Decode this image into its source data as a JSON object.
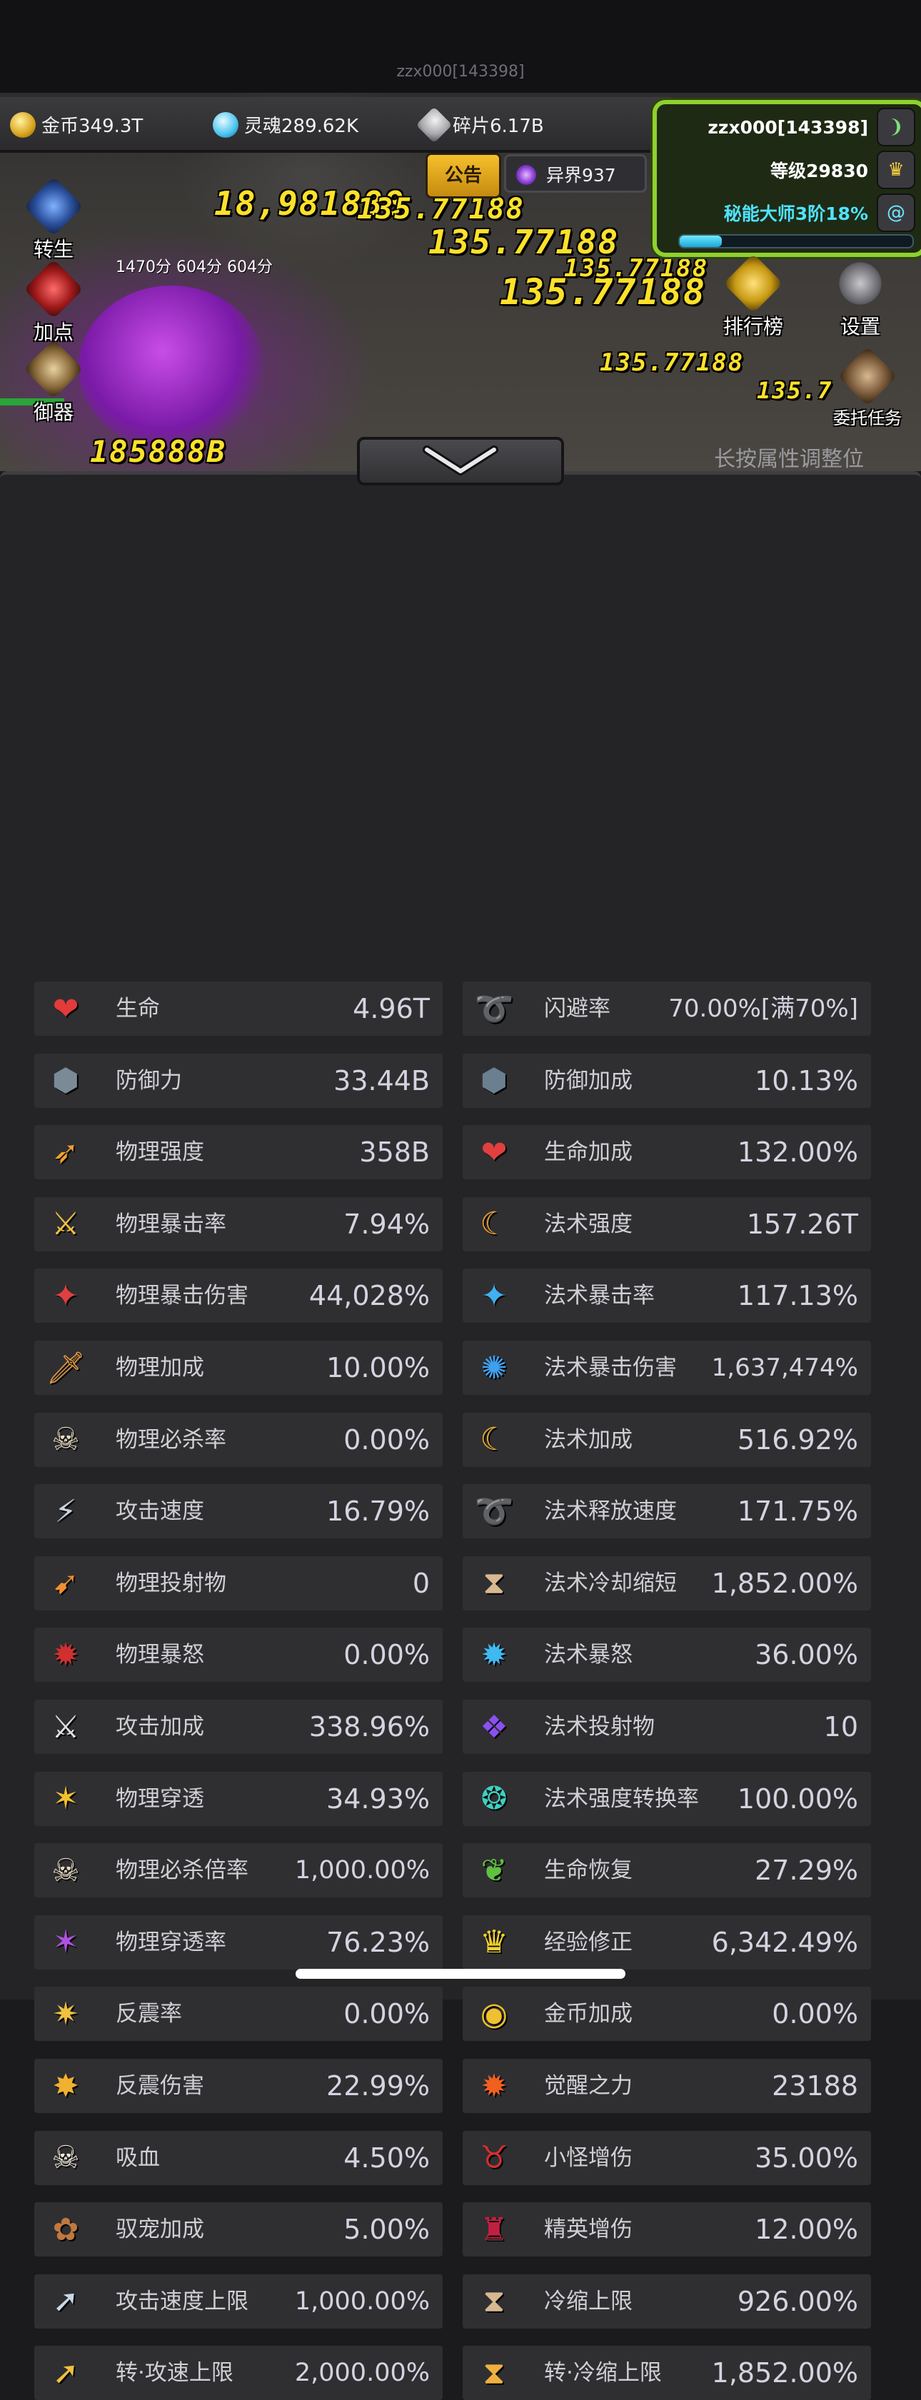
{
  "header": {
    "server_label": "zzx000[143398]",
    "resources": [
      {
        "icon": "gold-coin-icon",
        "label": "金币349.3T"
      },
      {
        "icon": "soul-icon",
        "label": "灵魂289.62K"
      },
      {
        "icon": "shard-icon",
        "label": "碎片6.17B"
      }
    ]
  },
  "player": {
    "name": "zzx000[143398]",
    "level": "等级29830",
    "title": "秘能大师3阶18%",
    "progress": 0.18
  },
  "buttons": {
    "notice": "公告",
    "realm": "异界937",
    "rebirth": "转生",
    "add_points": "加点",
    "gear": "御器",
    "leaderboard": "排行榜",
    "settings": "设置",
    "commission": "委托任务"
  },
  "scene": {
    "hint": "长按属性调整位",
    "small_label": "1470分 604分  604分",
    "damage_numbers": [
      "18,981888",
      "135.77188",
      "135.77188",
      "135.77188",
      "135.77188",
      "135.77188",
      "185888B",
      "135.7"
    ]
  },
  "stats_left": [
    {
      "icon": "heart-icon",
      "name": "生命",
      "value": "4.96T"
    },
    {
      "icon": "shield-icon",
      "name": "防御力",
      "value": "33.44B"
    },
    {
      "icon": "arrow-burst-icon",
      "name": "物理强度",
      "value": "358B"
    },
    {
      "icon": "crit-swords-icon",
      "name": "物理暴击率",
      "value": "7.94%"
    },
    {
      "icon": "crit-damage-icon",
      "name": "物理暴击伤害",
      "value": "44,028%"
    },
    {
      "icon": "sword-plus-icon",
      "name": "物理加成",
      "value": "10.00%"
    },
    {
      "icon": "skull-dagger-icon",
      "name": "物理必杀率",
      "value": "0.00%"
    },
    {
      "icon": "attack-speed-icon",
      "name": "攻击速度",
      "value": "16.79%"
    },
    {
      "icon": "projectile-icon",
      "name": "物理投射物",
      "value": "0"
    },
    {
      "icon": "rage-icon",
      "name": "物理暴怒",
      "value": "0.00%"
    },
    {
      "icon": "crossed-swords-icon",
      "name": "攻击加成",
      "value": "338.96%"
    },
    {
      "icon": "pierce-icon",
      "name": "物理穿透",
      "value": "34.93%"
    },
    {
      "icon": "skull-dagger-icon",
      "name": "物理必杀倍率",
      "value": "1,000.00%"
    },
    {
      "icon": "pierce-rate-icon",
      "name": "物理穿透率",
      "value": "76.23%"
    },
    {
      "icon": "reflect-icon",
      "name": "反震率",
      "value": "0.00%"
    },
    {
      "icon": "reflect-damage-icon",
      "name": "反震伤害",
      "value": "22.99%"
    },
    {
      "icon": "vampire-skull-icon",
      "name": "吸血",
      "value": "4.50%"
    },
    {
      "icon": "paw-icon",
      "name": "驭宠加成",
      "value": "5.00%"
    },
    {
      "icon": "speed-cap-icon",
      "name": "攻击速度上限",
      "value": "1,000.00%"
    },
    {
      "icon": "speed-cap-up-icon",
      "name": "转·攻速上限",
      "value": "2,000.00%"
    }
  ],
  "stats_right": [
    {
      "icon": "dodge-icon",
      "name": "闪避率",
      "value": "70.00%[满70%]"
    },
    {
      "icon": "shield-plus-icon",
      "name": "防御加成",
      "value": "10.13%"
    },
    {
      "icon": "heart-plus-icon",
      "name": "生命加成",
      "value": "132.00%"
    },
    {
      "icon": "magic-power-icon",
      "name": "法术强度",
      "value": "157.26T"
    },
    {
      "icon": "magic-crit-icon",
      "name": "法术暴击率",
      "value": "117.13%"
    },
    {
      "icon": "magic-crit-damage-icon",
      "name": "法术暴击伤害",
      "value": "1,637,474%"
    },
    {
      "icon": "magic-plus-icon",
      "name": "法术加成",
      "value": "516.92%"
    },
    {
      "icon": "cast-speed-icon",
      "name": "法术释放速度",
      "value": "171.75%"
    },
    {
      "icon": "hourglass-icon",
      "name": "法术冷却缩短",
      "value": "1,852.00%"
    },
    {
      "icon": "magic-rage-icon",
      "name": "法术暴怒",
      "value": "36.00%"
    },
    {
      "icon": "magic-projectile-icon",
      "name": "法术投射物",
      "value": "10"
    },
    {
      "icon": "magic-convert-icon",
      "name": "法术强度转换率",
      "value": "100.00%"
    },
    {
      "icon": "sprout-icon",
      "name": "生命恢复",
      "value": "27.29%"
    },
    {
      "icon": "crown-icon",
      "name": "经验修正",
      "value": "6,342.49%"
    },
    {
      "icon": "coins-icon",
      "name": "金币加成",
      "value": "0.00%"
    },
    {
      "icon": "awaken-flame-icon",
      "name": "觉醒之力",
      "value": "23188"
    },
    {
      "icon": "demon-icon",
      "name": "小怪增伤",
      "value": "35.00%"
    },
    {
      "icon": "elite-helmet-icon",
      "name": "精英增伤",
      "value": "12.00%"
    },
    {
      "icon": "hourglass-icon",
      "name": "冷缩上限",
      "value": "926.00%"
    },
    {
      "icon": "hourglass-up-icon",
      "name": "转·冷缩上限",
      "value": "1,852.00%"
    }
  ]
}
